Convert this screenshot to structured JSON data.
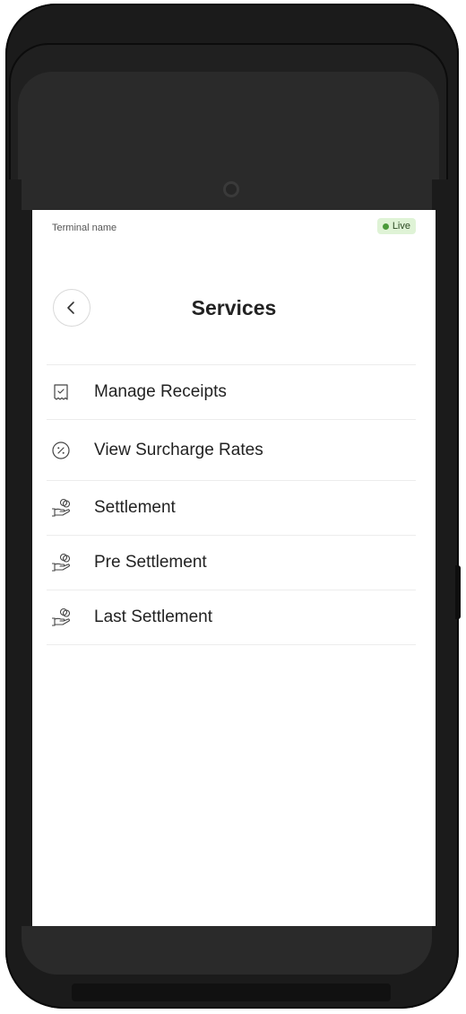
{
  "status": {
    "terminal_label": "Terminal name",
    "live_label": "Live"
  },
  "header": {
    "title": "Services"
  },
  "menu": {
    "items": [
      {
        "label": "Manage Receipts",
        "icon": "receipt-check-icon"
      },
      {
        "label": "View Surcharge Rates",
        "icon": "percent-circle-icon"
      },
      {
        "label": "Settlement",
        "icon": "hand-coins-icon"
      },
      {
        "label": "Pre Settlement",
        "icon": "hand-coins-icon"
      },
      {
        "label": "Last Settlement",
        "icon": "hand-coins-icon"
      }
    ]
  },
  "colors": {
    "device_body": "#1b1b1b",
    "live_badge_bg": "#dff3d6",
    "live_dot": "#4a9a3a",
    "text_primary": "#222222",
    "divider": "#ececec"
  }
}
